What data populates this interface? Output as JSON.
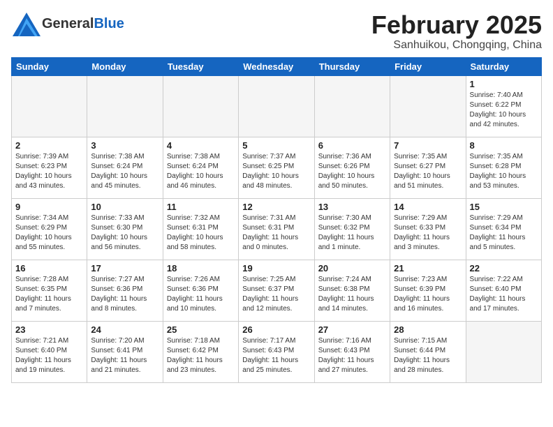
{
  "header": {
    "logo_general": "General",
    "logo_blue": "Blue",
    "month_title": "February 2025",
    "location": "Sanhuikou, Chongqing, China"
  },
  "weekdays": [
    "Sunday",
    "Monday",
    "Tuesday",
    "Wednesday",
    "Thursday",
    "Friday",
    "Saturday"
  ],
  "weeks": [
    [
      {
        "day": "",
        "info": ""
      },
      {
        "day": "",
        "info": ""
      },
      {
        "day": "",
        "info": ""
      },
      {
        "day": "",
        "info": ""
      },
      {
        "day": "",
        "info": ""
      },
      {
        "day": "",
        "info": ""
      },
      {
        "day": "1",
        "info": "Sunrise: 7:40 AM\nSunset: 6:22 PM\nDaylight: 10 hours\nand 42 minutes."
      }
    ],
    [
      {
        "day": "2",
        "info": "Sunrise: 7:39 AM\nSunset: 6:23 PM\nDaylight: 10 hours\nand 43 minutes."
      },
      {
        "day": "3",
        "info": "Sunrise: 7:38 AM\nSunset: 6:24 PM\nDaylight: 10 hours\nand 45 minutes."
      },
      {
        "day": "4",
        "info": "Sunrise: 7:38 AM\nSunset: 6:24 PM\nDaylight: 10 hours\nand 46 minutes."
      },
      {
        "day": "5",
        "info": "Sunrise: 7:37 AM\nSunset: 6:25 PM\nDaylight: 10 hours\nand 48 minutes."
      },
      {
        "day": "6",
        "info": "Sunrise: 7:36 AM\nSunset: 6:26 PM\nDaylight: 10 hours\nand 50 minutes."
      },
      {
        "day": "7",
        "info": "Sunrise: 7:35 AM\nSunset: 6:27 PM\nDaylight: 10 hours\nand 51 minutes."
      },
      {
        "day": "8",
        "info": "Sunrise: 7:35 AM\nSunset: 6:28 PM\nDaylight: 10 hours\nand 53 minutes."
      }
    ],
    [
      {
        "day": "9",
        "info": "Sunrise: 7:34 AM\nSunset: 6:29 PM\nDaylight: 10 hours\nand 55 minutes."
      },
      {
        "day": "10",
        "info": "Sunrise: 7:33 AM\nSunset: 6:30 PM\nDaylight: 10 hours\nand 56 minutes."
      },
      {
        "day": "11",
        "info": "Sunrise: 7:32 AM\nSunset: 6:31 PM\nDaylight: 10 hours\nand 58 minutes."
      },
      {
        "day": "12",
        "info": "Sunrise: 7:31 AM\nSunset: 6:31 PM\nDaylight: 11 hours\nand 0 minutes."
      },
      {
        "day": "13",
        "info": "Sunrise: 7:30 AM\nSunset: 6:32 PM\nDaylight: 11 hours\nand 1 minute."
      },
      {
        "day": "14",
        "info": "Sunrise: 7:29 AM\nSunset: 6:33 PM\nDaylight: 11 hours\nand 3 minutes."
      },
      {
        "day": "15",
        "info": "Sunrise: 7:29 AM\nSunset: 6:34 PM\nDaylight: 11 hours\nand 5 minutes."
      }
    ],
    [
      {
        "day": "16",
        "info": "Sunrise: 7:28 AM\nSunset: 6:35 PM\nDaylight: 11 hours\nand 7 minutes."
      },
      {
        "day": "17",
        "info": "Sunrise: 7:27 AM\nSunset: 6:36 PM\nDaylight: 11 hours\nand 8 minutes."
      },
      {
        "day": "18",
        "info": "Sunrise: 7:26 AM\nSunset: 6:36 PM\nDaylight: 11 hours\nand 10 minutes."
      },
      {
        "day": "19",
        "info": "Sunrise: 7:25 AM\nSunset: 6:37 PM\nDaylight: 11 hours\nand 12 minutes."
      },
      {
        "day": "20",
        "info": "Sunrise: 7:24 AM\nSunset: 6:38 PM\nDaylight: 11 hours\nand 14 minutes."
      },
      {
        "day": "21",
        "info": "Sunrise: 7:23 AM\nSunset: 6:39 PM\nDaylight: 11 hours\nand 16 minutes."
      },
      {
        "day": "22",
        "info": "Sunrise: 7:22 AM\nSunset: 6:40 PM\nDaylight: 11 hours\nand 17 minutes."
      }
    ],
    [
      {
        "day": "23",
        "info": "Sunrise: 7:21 AM\nSunset: 6:40 PM\nDaylight: 11 hours\nand 19 minutes."
      },
      {
        "day": "24",
        "info": "Sunrise: 7:20 AM\nSunset: 6:41 PM\nDaylight: 11 hours\nand 21 minutes."
      },
      {
        "day": "25",
        "info": "Sunrise: 7:18 AM\nSunset: 6:42 PM\nDaylight: 11 hours\nand 23 minutes."
      },
      {
        "day": "26",
        "info": "Sunrise: 7:17 AM\nSunset: 6:43 PM\nDaylight: 11 hours\nand 25 minutes."
      },
      {
        "day": "27",
        "info": "Sunrise: 7:16 AM\nSunset: 6:43 PM\nDaylight: 11 hours\nand 27 minutes."
      },
      {
        "day": "28",
        "info": "Sunrise: 7:15 AM\nSunset: 6:44 PM\nDaylight: 11 hours\nand 28 minutes."
      },
      {
        "day": "",
        "info": ""
      }
    ]
  ]
}
